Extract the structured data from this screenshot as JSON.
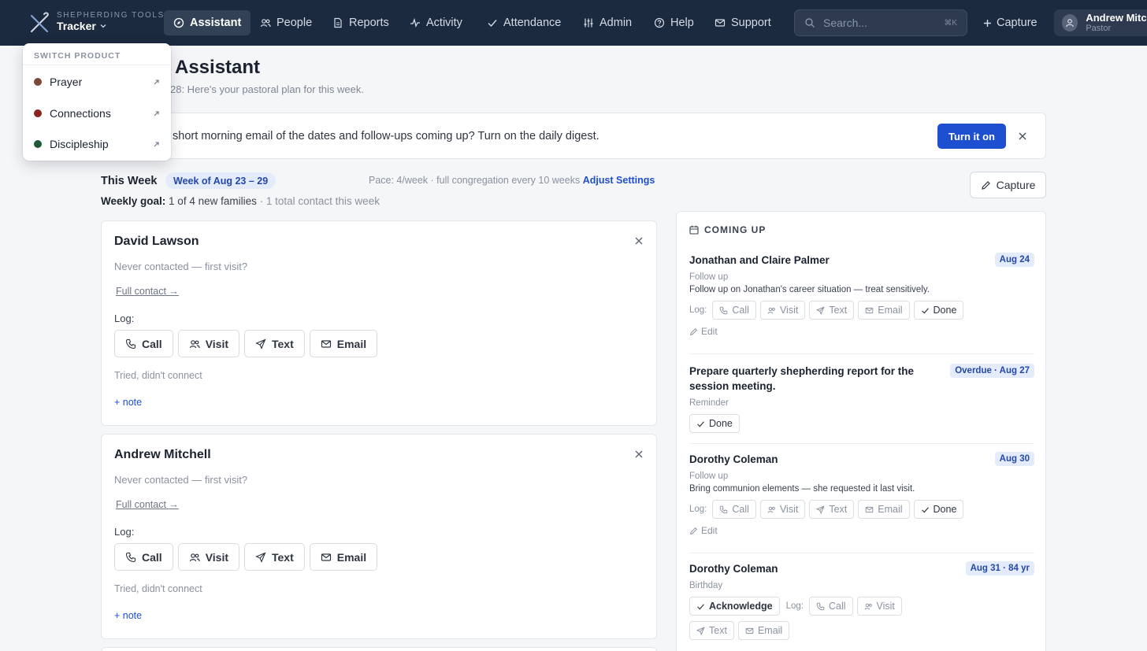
{
  "brand": {
    "kicker": "SHEPHERDING TOOLS",
    "name": "Tracker"
  },
  "nav": [
    {
      "label": "Assistant",
      "icon": "compass-icon"
    },
    {
      "label": "People",
      "icon": "people-icon"
    },
    {
      "label": "Reports",
      "icon": "document-icon"
    },
    {
      "label": "Activity",
      "icon": "pulse-icon"
    },
    {
      "label": "Attendance",
      "icon": "check-icon"
    },
    {
      "label": "Admin",
      "icon": "sliders-icon"
    },
    {
      "label": "Help",
      "icon": "help-icon"
    },
    {
      "label": "Support",
      "icon": "mail-icon"
    }
  ],
  "search": {
    "placeholder": "Search...",
    "shortcut": "⌘K"
  },
  "nav_capture": "Capture",
  "user": {
    "name": "Andrew Mitchell",
    "role": "Pastor"
  },
  "page": {
    "title": "Assistant",
    "subtitle": "28: Here's your pastoral plan for this week."
  },
  "banner": {
    "text": "short morning email of the dates and follow-ups coming up? Turn on the daily digest.",
    "button": "Turn it on"
  },
  "week": {
    "title": "This Week",
    "badge": "Week of Aug 23 – 29",
    "pace": "Pace: 4/week · full congregation every 10 weeks",
    "adjust": "Adjust Settings",
    "goal_label": "Weekly goal:",
    "goal_value": "1 of 4 new families",
    "goal_extra": "· 1 total contact this week",
    "capture": "Capture"
  },
  "contacts": [
    {
      "name": "David Lawson",
      "status": "Never contacted — first visit?",
      "link": "Full contact →",
      "log_label": "Log:",
      "actions": [
        "Call",
        "Visit",
        "Text",
        "Email"
      ],
      "tried": "Tried, didn't connect",
      "note": "+ note"
    },
    {
      "name": "Andrew Mitchell",
      "status": "Never contacted — first visit?",
      "link": "Full contact →",
      "log_label": "Log:",
      "actions": [
        "Call",
        "Visit",
        "Text",
        "Email"
      ],
      "tried": "Tried, didn't connect",
      "note": "+ note"
    }
  ],
  "coming_up": {
    "title": "COMING UP",
    "items": [
      {
        "title": "Jonathan and Claire Palmer",
        "date": "Aug 24",
        "type": "Follow up",
        "desc": "Follow up on Jonathan's career situation — treat sensitively.",
        "log_label": "Log:",
        "actions": [
          "Call",
          "Visit",
          "Text",
          "Email"
        ],
        "done": "Done",
        "edit": "Edit"
      },
      {
        "title": "Prepare quarterly shepherding report for the session meeting.",
        "date": "Overdue · Aug 27",
        "type": "Reminder",
        "done": "Done"
      },
      {
        "title": "Dorothy Coleman",
        "date": "Aug 30",
        "type": "Follow up",
        "desc": "Bring communion elements — she requested it last visit.",
        "log_label": "Log:",
        "actions": [
          "Call",
          "Visit",
          "Text",
          "Email"
        ],
        "done": "Done",
        "edit": "Edit"
      },
      {
        "title": "Dorothy Coleman",
        "date": "Aug 31 · 84 yr",
        "type": "Birthday",
        "acknowledge": "Acknowledge",
        "log_label": "Log:",
        "actions": [
          "Call",
          "Visit",
          "Text",
          "Email"
        ]
      }
    ]
  },
  "switcher": {
    "title": "SWITCH PRODUCT",
    "items": [
      {
        "label": "Prayer",
        "color": "#7a4a3a"
      },
      {
        "label": "Connections",
        "color": "#8b2323"
      },
      {
        "label": "Discipleship",
        "color": "#1f5a3a"
      }
    ]
  },
  "colors": {
    "nav_bg": "#1c2a40",
    "accent": "#1f4fd1",
    "badge_bg": "#e4ecfb"
  }
}
